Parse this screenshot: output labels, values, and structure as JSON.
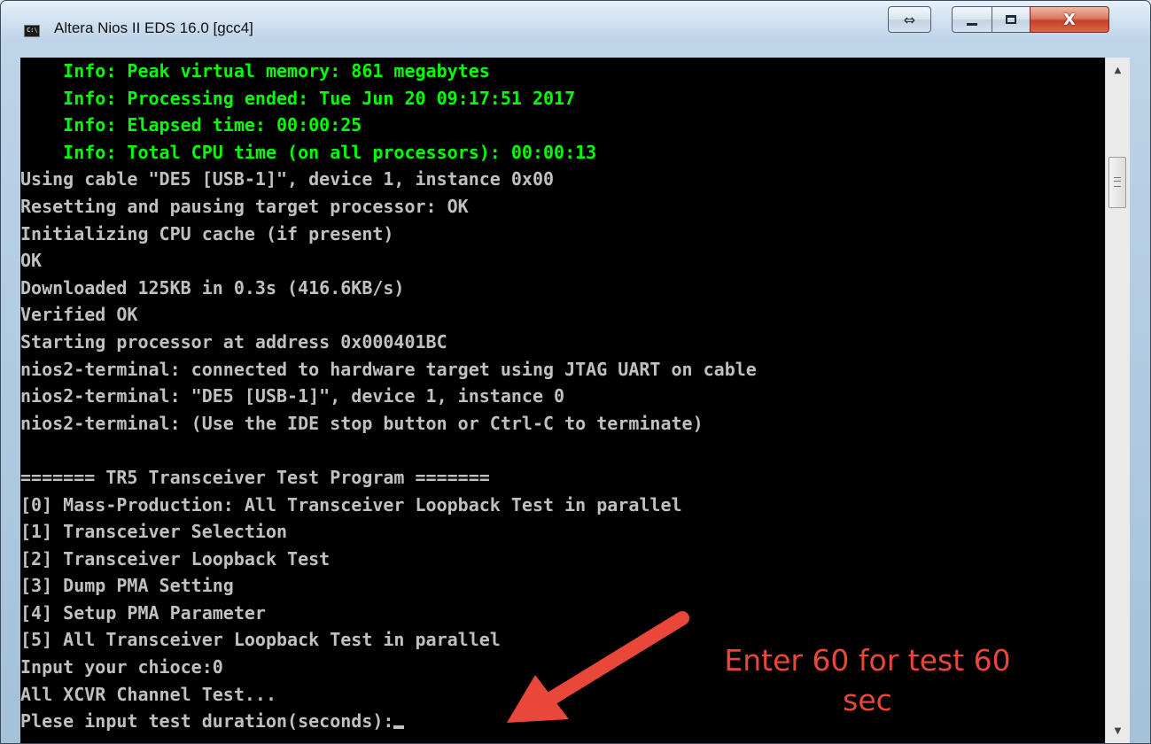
{
  "window": {
    "title": "Altera Nios II EDS 16.0 [gcc4]",
    "icon_label": "C:\\",
    "buttons": {
      "resize_icon": "⇔",
      "minimize_icon": "minimize-icon",
      "maximize_icon": "maximize-icon",
      "close_label": "X"
    }
  },
  "console": {
    "lines": [
      {
        "text": "    Info: Peak virtual memory: 861 megabytes",
        "color": "green"
      },
      {
        "text": "    Info: Processing ended: Tue Jun 20 09:17:51 2017",
        "color": "green"
      },
      {
        "text": "    Info: Elapsed time: 00:00:25",
        "color": "green"
      },
      {
        "text": "    Info: Total CPU time (on all processors): 00:00:13",
        "color": "green"
      },
      {
        "text": "Using cable \"DE5 [USB-1]\", device 1, instance 0x00",
        "color": "gray"
      },
      {
        "text": "Resetting and pausing target processor: OK",
        "color": "gray"
      },
      {
        "text": "Initializing CPU cache (if present)",
        "color": "gray"
      },
      {
        "text": "OK",
        "color": "gray"
      },
      {
        "text": "Downloaded 125KB in 0.3s (416.6KB/s)",
        "color": "gray"
      },
      {
        "text": "Verified OK",
        "color": "gray"
      },
      {
        "text": "Starting processor at address 0x000401BC",
        "color": "gray"
      },
      {
        "text": "nios2-terminal: connected to hardware target using JTAG UART on cable",
        "color": "gray"
      },
      {
        "text": "nios2-terminal: \"DE5 [USB-1]\", device 1, instance 0",
        "color": "gray"
      },
      {
        "text": "nios2-terminal: (Use the IDE stop button or Ctrl-C to terminate)",
        "color": "gray"
      },
      {
        "text": "",
        "color": "gray"
      },
      {
        "text": "======= TR5 Transceiver Test Program =======",
        "color": "gray"
      },
      {
        "text": "[0] Mass-Production: All Transceiver Loopback Test in parallel",
        "color": "gray"
      },
      {
        "text": "[1] Transceiver Selection",
        "color": "gray"
      },
      {
        "text": "[2] Transceiver Loopback Test",
        "color": "gray"
      },
      {
        "text": "[3] Dump PMA Setting",
        "color": "gray"
      },
      {
        "text": "[4] Setup PMA Parameter",
        "color": "gray"
      },
      {
        "text": "[5] All Transceiver Loopback Test in parallel",
        "color": "gray"
      },
      {
        "text": "Input your chioce:0",
        "color": "gray"
      },
      {
        "text": "All XCVR Channel Test...",
        "color": "gray"
      },
      {
        "text": "Plese input test duration(seconds):",
        "color": "gray",
        "cursor": true
      }
    ]
  },
  "annotation": {
    "line1": "Enter 60 for test 60",
    "line2": "sec",
    "color": "#e8473a"
  },
  "colors": {
    "console_bg": "#000000",
    "console_text": "#c0c0c0",
    "info_text": "#00ff00"
  }
}
